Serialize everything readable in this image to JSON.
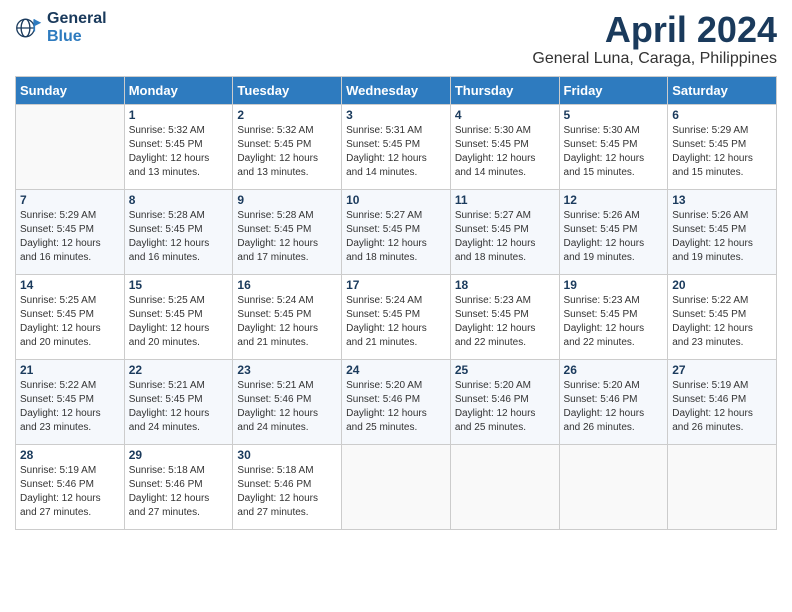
{
  "header": {
    "logo_line1": "General",
    "logo_line2": "Blue",
    "title": "April 2024",
    "subtitle": "General Luna, Caraga, Philippines"
  },
  "days_of_week": [
    "Sunday",
    "Monday",
    "Tuesday",
    "Wednesday",
    "Thursday",
    "Friday",
    "Saturday"
  ],
  "weeks": [
    [
      {
        "day": "",
        "info": ""
      },
      {
        "day": "1",
        "info": "Sunrise: 5:32 AM\nSunset: 5:45 PM\nDaylight: 12 hours\nand 13 minutes."
      },
      {
        "day": "2",
        "info": "Sunrise: 5:32 AM\nSunset: 5:45 PM\nDaylight: 12 hours\nand 13 minutes."
      },
      {
        "day": "3",
        "info": "Sunrise: 5:31 AM\nSunset: 5:45 PM\nDaylight: 12 hours\nand 14 minutes."
      },
      {
        "day": "4",
        "info": "Sunrise: 5:30 AM\nSunset: 5:45 PM\nDaylight: 12 hours\nand 14 minutes."
      },
      {
        "day": "5",
        "info": "Sunrise: 5:30 AM\nSunset: 5:45 PM\nDaylight: 12 hours\nand 15 minutes."
      },
      {
        "day": "6",
        "info": "Sunrise: 5:29 AM\nSunset: 5:45 PM\nDaylight: 12 hours\nand 15 minutes."
      }
    ],
    [
      {
        "day": "7",
        "info": "Sunrise: 5:29 AM\nSunset: 5:45 PM\nDaylight: 12 hours\nand 16 minutes."
      },
      {
        "day": "8",
        "info": "Sunrise: 5:28 AM\nSunset: 5:45 PM\nDaylight: 12 hours\nand 16 minutes."
      },
      {
        "day": "9",
        "info": "Sunrise: 5:28 AM\nSunset: 5:45 PM\nDaylight: 12 hours\nand 17 minutes."
      },
      {
        "day": "10",
        "info": "Sunrise: 5:27 AM\nSunset: 5:45 PM\nDaylight: 12 hours\nand 18 minutes."
      },
      {
        "day": "11",
        "info": "Sunrise: 5:27 AM\nSunset: 5:45 PM\nDaylight: 12 hours\nand 18 minutes."
      },
      {
        "day": "12",
        "info": "Sunrise: 5:26 AM\nSunset: 5:45 PM\nDaylight: 12 hours\nand 19 minutes."
      },
      {
        "day": "13",
        "info": "Sunrise: 5:26 AM\nSunset: 5:45 PM\nDaylight: 12 hours\nand 19 minutes."
      }
    ],
    [
      {
        "day": "14",
        "info": "Sunrise: 5:25 AM\nSunset: 5:45 PM\nDaylight: 12 hours\nand 20 minutes."
      },
      {
        "day": "15",
        "info": "Sunrise: 5:25 AM\nSunset: 5:45 PM\nDaylight: 12 hours\nand 20 minutes."
      },
      {
        "day": "16",
        "info": "Sunrise: 5:24 AM\nSunset: 5:45 PM\nDaylight: 12 hours\nand 21 minutes."
      },
      {
        "day": "17",
        "info": "Sunrise: 5:24 AM\nSunset: 5:45 PM\nDaylight: 12 hours\nand 21 minutes."
      },
      {
        "day": "18",
        "info": "Sunrise: 5:23 AM\nSunset: 5:45 PM\nDaylight: 12 hours\nand 22 minutes."
      },
      {
        "day": "19",
        "info": "Sunrise: 5:23 AM\nSunset: 5:45 PM\nDaylight: 12 hours\nand 22 minutes."
      },
      {
        "day": "20",
        "info": "Sunrise: 5:22 AM\nSunset: 5:45 PM\nDaylight: 12 hours\nand 23 minutes."
      }
    ],
    [
      {
        "day": "21",
        "info": "Sunrise: 5:22 AM\nSunset: 5:45 PM\nDaylight: 12 hours\nand 23 minutes."
      },
      {
        "day": "22",
        "info": "Sunrise: 5:21 AM\nSunset: 5:45 PM\nDaylight: 12 hours\nand 24 minutes."
      },
      {
        "day": "23",
        "info": "Sunrise: 5:21 AM\nSunset: 5:46 PM\nDaylight: 12 hours\nand 24 minutes."
      },
      {
        "day": "24",
        "info": "Sunrise: 5:20 AM\nSunset: 5:46 PM\nDaylight: 12 hours\nand 25 minutes."
      },
      {
        "day": "25",
        "info": "Sunrise: 5:20 AM\nSunset: 5:46 PM\nDaylight: 12 hours\nand 25 minutes."
      },
      {
        "day": "26",
        "info": "Sunrise: 5:20 AM\nSunset: 5:46 PM\nDaylight: 12 hours\nand 26 minutes."
      },
      {
        "day": "27",
        "info": "Sunrise: 5:19 AM\nSunset: 5:46 PM\nDaylight: 12 hours\nand 26 minutes."
      }
    ],
    [
      {
        "day": "28",
        "info": "Sunrise: 5:19 AM\nSunset: 5:46 PM\nDaylight: 12 hours\nand 27 minutes."
      },
      {
        "day": "29",
        "info": "Sunrise: 5:18 AM\nSunset: 5:46 PM\nDaylight: 12 hours\nand 27 minutes."
      },
      {
        "day": "30",
        "info": "Sunrise: 5:18 AM\nSunset: 5:46 PM\nDaylight: 12 hours\nand 27 minutes."
      },
      {
        "day": "",
        "info": ""
      },
      {
        "day": "",
        "info": ""
      },
      {
        "day": "",
        "info": ""
      },
      {
        "day": "",
        "info": ""
      }
    ]
  ]
}
